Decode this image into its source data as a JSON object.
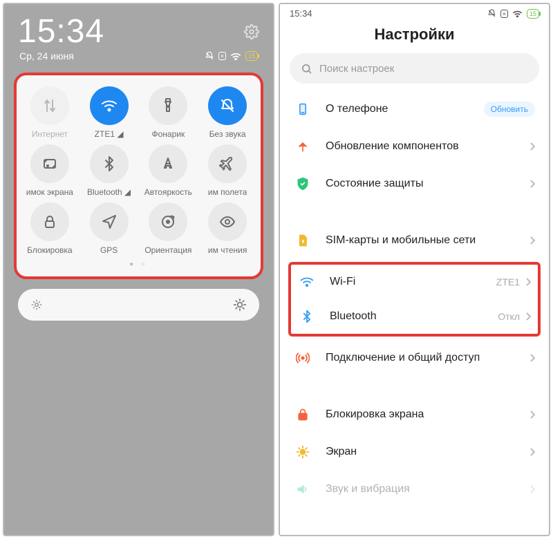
{
  "left": {
    "time": "15:34",
    "date": "Ср, 24 июня",
    "battery": "15",
    "tiles": [
      {
        "name": "internet",
        "label": "Интернет",
        "icon": "data",
        "state": "disabled"
      },
      {
        "name": "wifi",
        "label": "ZTE1",
        "icon": "wifi",
        "state": "active",
        "signal": true
      },
      {
        "name": "flashlight",
        "label": "Фонарик",
        "icon": "flashlight",
        "state": "off"
      },
      {
        "name": "mute",
        "label": "Без звука",
        "icon": "mute",
        "state": "active"
      },
      {
        "name": "screenshot",
        "label": "имок экрана",
        "icon": "screenshot",
        "state": "off"
      },
      {
        "name": "bluetooth",
        "label": "Bluetooth",
        "icon": "bluetooth",
        "state": "off",
        "signal": true
      },
      {
        "name": "autobright",
        "label": "Автояркость",
        "icon": "autobright",
        "state": "off"
      },
      {
        "name": "airplane",
        "label": "им полета",
        "icon": "airplane",
        "state": "off"
      },
      {
        "name": "lock",
        "label": "Блокировка",
        "icon": "lock",
        "state": "off"
      },
      {
        "name": "gps",
        "label": "GPS",
        "icon": "gps",
        "state": "off"
      },
      {
        "name": "orientation",
        "label": "Ориентация",
        "icon": "orientation",
        "state": "off"
      },
      {
        "name": "reading",
        "label": "им чтения",
        "icon": "eye",
        "state": "off"
      }
    ]
  },
  "right": {
    "time": "15:34",
    "battery": "15",
    "title": "Настройки",
    "search_placeholder": "Поиск настроек",
    "items": [
      {
        "name": "about",
        "label": "О телефоне",
        "icon": "phone",
        "color": "#3a9ef5",
        "pill": "Обновить"
      },
      {
        "name": "components",
        "label": "Обновление компонентов",
        "icon": "arrow-up",
        "color": "#f3643d",
        "chev": true
      },
      {
        "name": "security",
        "label": "Состояние защиты",
        "icon": "shield",
        "color": "#2ec47a",
        "chev": true
      },
      {
        "gap": true
      },
      {
        "name": "sim",
        "label": "SIM-карты и мобильные сети",
        "icon": "sim",
        "color": "#f2b82f",
        "chev": true
      },
      {
        "highlight_start": true
      },
      {
        "name": "wifi",
        "label": "Wi-Fi",
        "icon": "wifi",
        "color": "#3a9ef5",
        "value": "ZTE1",
        "chev": true
      },
      {
        "name": "bluetooth",
        "label": "Bluetooth",
        "icon": "bluetooth",
        "color": "#3a9ef5",
        "value": "Откл",
        "chev": true
      },
      {
        "highlight_end": true
      },
      {
        "name": "tethering",
        "label": "Подключение и общий доступ",
        "icon": "tether",
        "color": "#f3643d",
        "chev": true
      },
      {
        "gap": true
      },
      {
        "name": "lockscreen",
        "label": "Блокировка экрана",
        "icon": "lock-sq",
        "color": "#f3643d",
        "chev": true
      },
      {
        "name": "display",
        "label": "Экран",
        "icon": "sun",
        "color": "#f2b82f",
        "chev": true
      },
      {
        "name": "sound",
        "label": "Звук и вибрация",
        "icon": "sound",
        "color": "#2ec47a",
        "chev": true,
        "cut": true
      }
    ]
  }
}
